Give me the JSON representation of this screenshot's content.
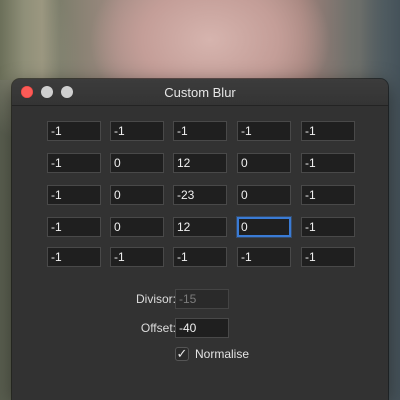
{
  "window": {
    "title": "Custom Blur"
  },
  "matrix": [
    [
      "-1",
      "-1",
      "-1",
      "-1",
      "-1"
    ],
    [
      "-1",
      "0",
      "12",
      "0",
      "-1"
    ],
    [
      "-1",
      "0",
      "-23",
      "0",
      "-1"
    ],
    [
      "-1",
      "0",
      "12",
      "0",
      "-1"
    ],
    [
      "-1",
      "-1",
      "-1",
      "-1",
      "-1"
    ]
  ],
  "focused_cell": {
    "row": 3,
    "col": 3
  },
  "divisor": {
    "label": "Divisor:",
    "value": "-15",
    "enabled": false
  },
  "offset": {
    "label": "Offset:",
    "value": "-40"
  },
  "normalise": {
    "label": "Normalise",
    "checked": true,
    "check_glyph": "✓"
  },
  "colors": {
    "close": "#fc5b57",
    "focus": "#3a7bd5",
    "window_bg": "#323232"
  }
}
